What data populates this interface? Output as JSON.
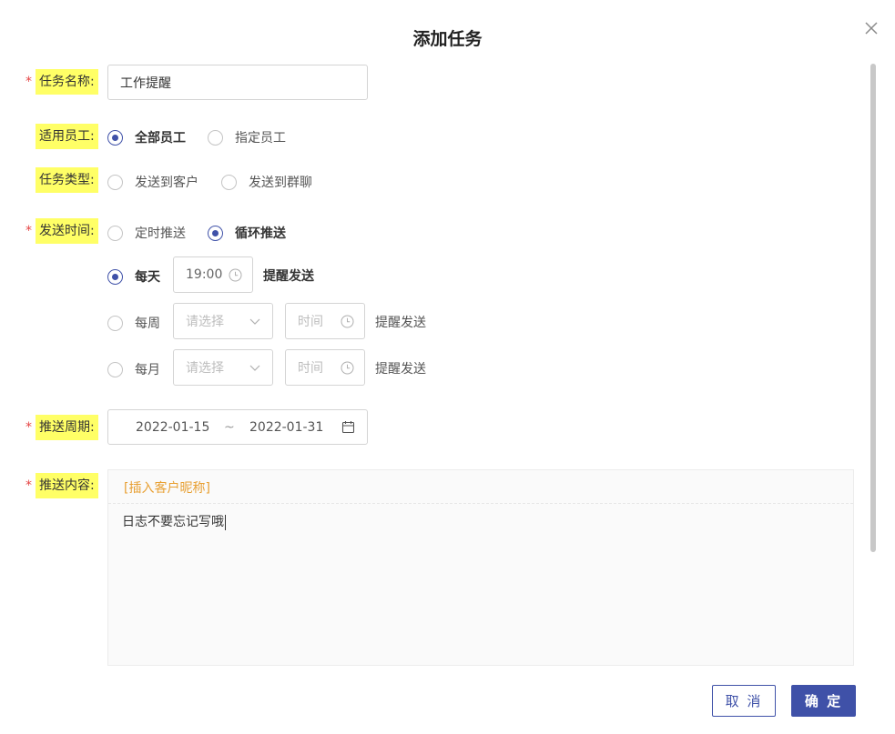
{
  "dialog": {
    "title": "添加任务",
    "close_icon": "close-icon"
  },
  "form": {
    "task_name": {
      "label": "任务名称:",
      "required": true,
      "value": "工作提醒"
    },
    "staff": {
      "label": "适用员工:",
      "required": false,
      "options": [
        {
          "label": "全部员工",
          "selected": true
        },
        {
          "label": "指定员工",
          "selected": false
        }
      ]
    },
    "task_type": {
      "label": "任务类型:",
      "required": false,
      "options": [
        {
          "label": "发送到客户",
          "selected": false
        },
        {
          "label": "发送到群聊",
          "selected": false
        }
      ]
    },
    "send_time": {
      "label": "发送时间:",
      "required": true,
      "options": [
        {
          "label": "定时推送",
          "selected": false
        },
        {
          "label": "循环推送",
          "selected": true
        }
      ],
      "cycle": {
        "daily": {
          "label": "每天",
          "selected": true,
          "time": "19:00",
          "suffix": "提醒发送"
        },
        "weekly": {
          "label": "每周",
          "selected": false,
          "select_placeholder": "请选择",
          "time_placeholder": "时间",
          "suffix": "提醒发送"
        },
        "monthly": {
          "label": "每月",
          "selected": false,
          "select_placeholder": "请选择",
          "time_placeholder": "时间",
          "suffix": "提醒发送"
        }
      }
    },
    "period": {
      "label": "推送周期:",
      "required": true,
      "start": "2022-01-15",
      "separator": "~",
      "end": "2022-01-31",
      "icon": "calendar-icon"
    },
    "content": {
      "label": "推送内容:",
      "required": true,
      "insert_link": "[插入客户昵称]",
      "text": "日志不要忘记写哦"
    }
  },
  "footer": {
    "cancel_label": "取 消",
    "ok_label": "确 定"
  },
  "colors": {
    "accent": "#3f51a8",
    "required": "#e54545",
    "highlight": "#ffff66",
    "link": "#e8a033"
  }
}
